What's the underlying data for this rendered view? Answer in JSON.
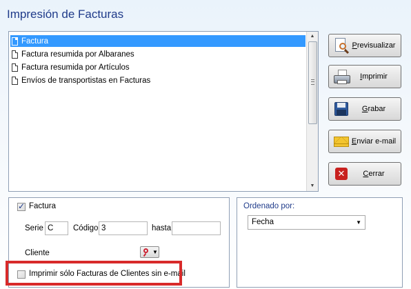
{
  "window": {
    "title": "Impresión de Facturas"
  },
  "report_list": {
    "items": [
      {
        "label": "Factura",
        "selected": true
      },
      {
        "label": "Factura resumida por Albaranes",
        "selected": false
      },
      {
        "label": "Factura resumida por Artículos",
        "selected": false
      },
      {
        "label": "Envíos de transportistas en Facturas",
        "selected": false
      }
    ]
  },
  "buttons": {
    "preview": {
      "pre": "",
      "key": "P",
      "post": "revisualizar",
      "icon": "preview-icon"
    },
    "print": {
      "pre": "",
      "key": "I",
      "post": "mprimir",
      "icon": "printer-icon"
    },
    "save": {
      "pre": "",
      "key": "G",
      "post": "rabar",
      "icon": "floppy-disk-icon"
    },
    "email": {
      "pre": "",
      "key": "E",
      "post": "nviar e-mail",
      "icon": "envelope-icon"
    },
    "close": {
      "pre": "",
      "key": "C",
      "post": "errar",
      "icon": "close-icon"
    }
  },
  "filters": {
    "factura_label": "Factura",
    "factura_checked": true,
    "serie_label": "Serie",
    "serie_value": "C",
    "codigo_label": "Código",
    "codigo_value": "3",
    "hasta_label": "hasta",
    "hasta_value": "",
    "cliente_label": "Cliente",
    "only_no_email_label": "Imprimir sólo Facturas de Clientes sin e-mail",
    "only_no_email_checked": false
  },
  "order": {
    "title": "Ordenado por:",
    "selected": "Fecha"
  },
  "colors": {
    "title": "#1f3b8a",
    "selection": "#3399ff",
    "highlight_box": "#d82a2a"
  }
}
